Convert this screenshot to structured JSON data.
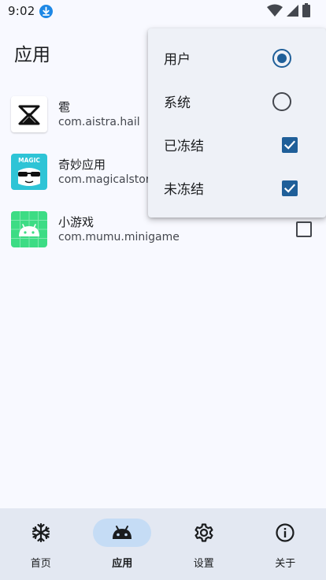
{
  "status_bar": {
    "time": "9:02",
    "download_icon": "download-icon",
    "wifi_icon": "wifi-icon",
    "signal_icon": "cell-signal-icon",
    "battery_icon": "battery-icon"
  },
  "header": {
    "title": "应用"
  },
  "apps": [
    {
      "name": "雹",
      "package": "com.aistra.hail",
      "icon": "hail-app-icon",
      "checked": false
    },
    {
      "name": "奇妙应用",
      "package": "com.magicalstory",
      "icon": "magic-app-icon",
      "icon_text": "MAGIC",
      "checked": false
    },
    {
      "name": "小游戏",
      "package": "com.mumu.minigame",
      "icon": "android-app-icon",
      "checked": false
    }
  ],
  "filter_menu": {
    "items": [
      {
        "label": "用户",
        "type": "radio",
        "selected": true
      },
      {
        "label": "系统",
        "type": "radio",
        "selected": false
      },
      {
        "label": "已冻结",
        "type": "checkbox",
        "checked": true
      },
      {
        "label": "未冻结",
        "type": "checkbox",
        "checked": true
      }
    ]
  },
  "bottom_nav": {
    "items": [
      {
        "label": "首页",
        "icon": "snowflake-icon",
        "active": false
      },
      {
        "label": "应用",
        "icon": "android-icon",
        "active": true
      },
      {
        "label": "设置",
        "icon": "gear-icon",
        "active": false
      },
      {
        "label": "关于",
        "icon": "info-icon",
        "active": false
      }
    ]
  },
  "colors": {
    "accent": "#1f5f99",
    "nav_background": "#e3e8f2",
    "nav_active_pill": "#c5dcf5",
    "background": "#f8f9ff"
  }
}
